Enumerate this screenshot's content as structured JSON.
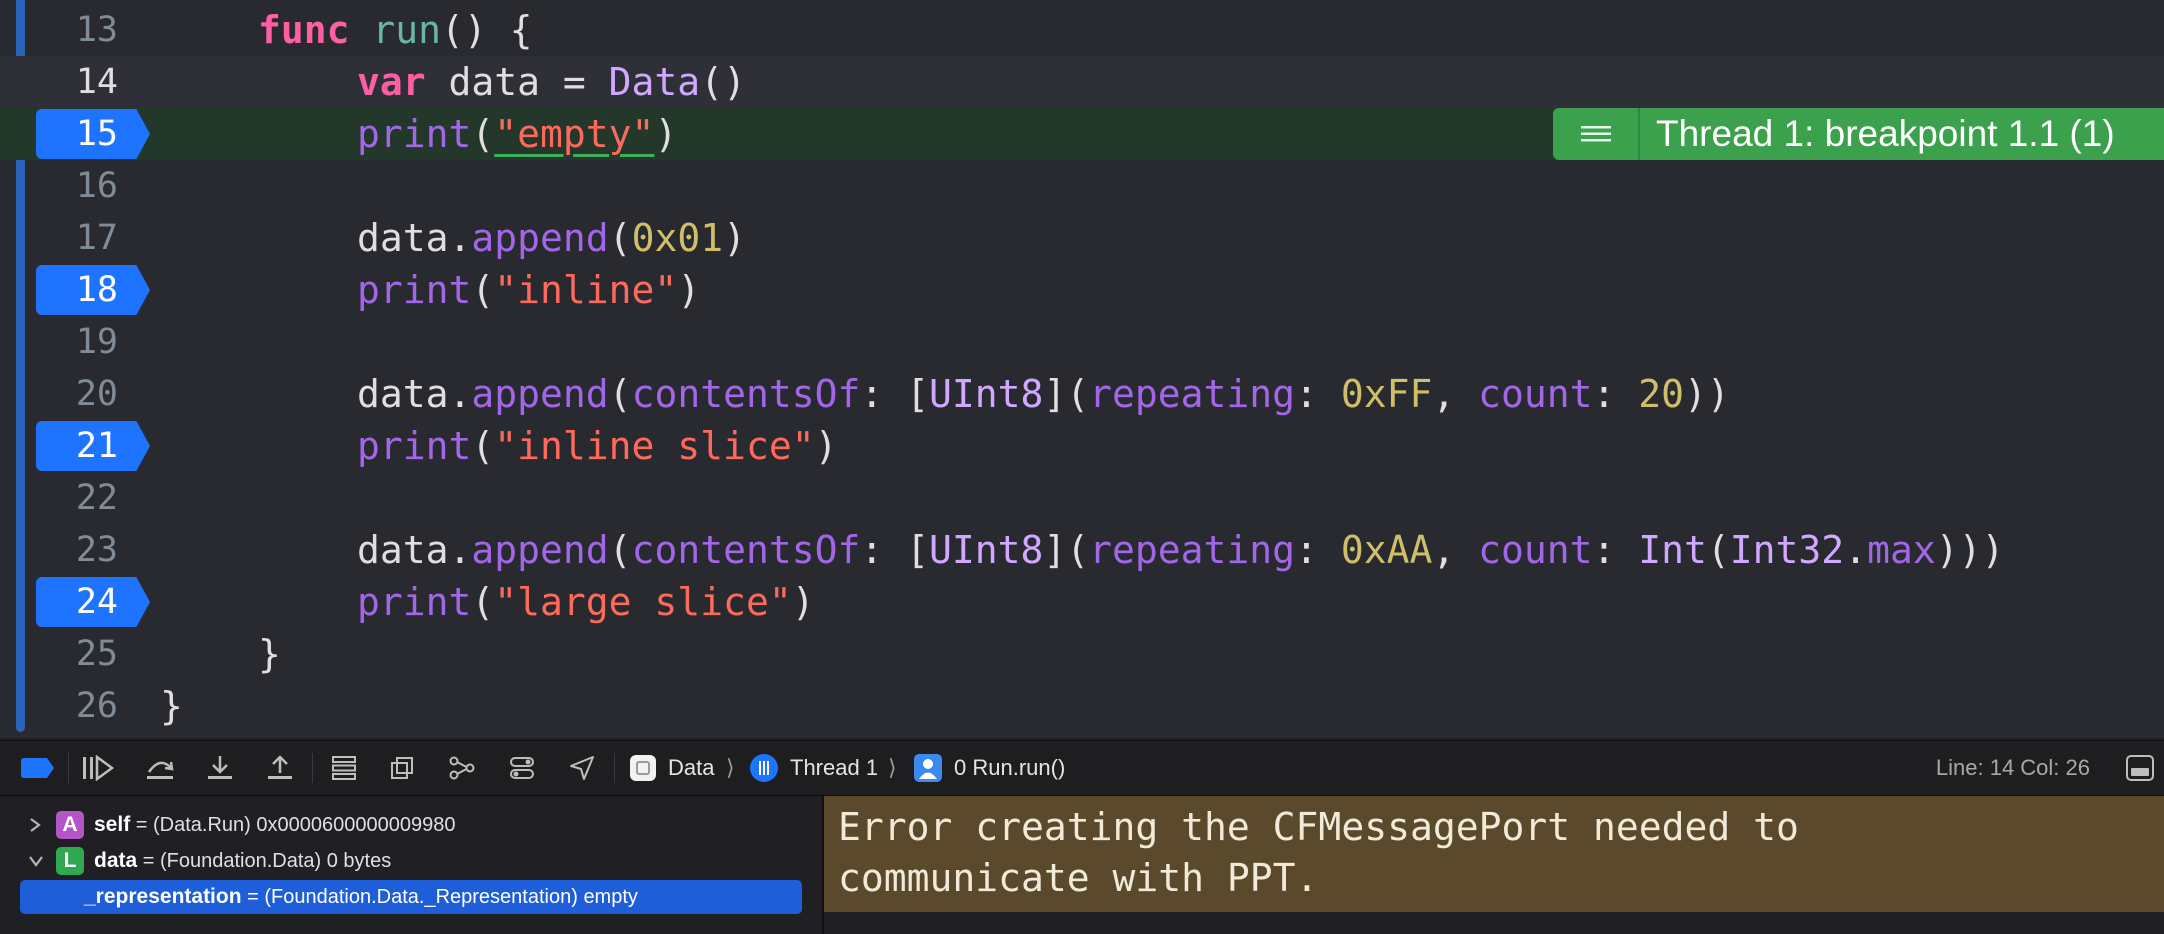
{
  "editor": {
    "lines": [
      {
        "num": "13",
        "tokens": [
          [
            "kw",
            "func"
          ],
          [
            "pl",
            " "
          ],
          [
            "fn",
            "run"
          ],
          [
            "pl",
            "() {"
          ]
        ]
      },
      {
        "num": "14",
        "tokens": [
          [
            "kw",
            "var"
          ],
          [
            "pl",
            " data = "
          ],
          [
            "ty",
            "Data"
          ],
          [
            "pl",
            "()"
          ]
        ]
      },
      {
        "num": "15",
        "tokens": [
          [
            "me",
            "print"
          ],
          [
            "pl",
            "("
          ],
          [
            "str-u",
            "\"empty\""
          ],
          [
            "pl",
            ")"
          ]
        ]
      },
      {
        "num": "16",
        "tokens": []
      },
      {
        "num": "17",
        "tokens": [
          [
            "pl",
            "data."
          ],
          [
            "me",
            "append"
          ],
          [
            "pl",
            "("
          ],
          [
            "num",
            "0x01"
          ],
          [
            "pl",
            ")"
          ]
        ]
      },
      {
        "num": "18",
        "tokens": [
          [
            "me",
            "print"
          ],
          [
            "pl",
            "("
          ],
          [
            "str",
            "\"inline\""
          ],
          [
            "pl",
            ")"
          ]
        ]
      },
      {
        "num": "19",
        "tokens": []
      },
      {
        "num": "20",
        "tokens": [
          [
            "pl",
            "data."
          ],
          [
            "me",
            "append"
          ],
          [
            "pl",
            "("
          ],
          [
            "me",
            "contentsOf"
          ],
          [
            "pl",
            ": ["
          ],
          [
            "ty",
            "UInt8"
          ],
          [
            "pl",
            "]("
          ],
          [
            "me",
            "repeating"
          ],
          [
            "pl",
            ": "
          ],
          [
            "num",
            "0xFF"
          ],
          [
            "pl",
            ", "
          ],
          [
            "me",
            "count"
          ],
          [
            "pl",
            ": "
          ],
          [
            "num",
            "20"
          ],
          [
            "pl",
            "))"
          ]
        ]
      },
      {
        "num": "21",
        "tokens": [
          [
            "me",
            "print"
          ],
          [
            "pl",
            "("
          ],
          [
            "str",
            "\"inline slice\""
          ],
          [
            "pl",
            ")"
          ]
        ]
      },
      {
        "num": "22",
        "tokens": []
      },
      {
        "num": "23",
        "tokens": [
          [
            "pl",
            "data."
          ],
          [
            "me",
            "append"
          ],
          [
            "pl",
            "("
          ],
          [
            "me",
            "contentsOf"
          ],
          [
            "pl",
            ": ["
          ],
          [
            "ty",
            "UInt8"
          ],
          [
            "pl",
            "]("
          ],
          [
            "me",
            "repeating"
          ],
          [
            "pl",
            ": "
          ],
          [
            "num",
            "0xAA"
          ],
          [
            "pl",
            ", "
          ],
          [
            "me",
            "count"
          ],
          [
            "pl",
            ": "
          ],
          [
            "ty",
            "Int"
          ],
          [
            "pl",
            "("
          ],
          [
            "ty",
            "Int32"
          ],
          [
            "pl",
            "."
          ],
          [
            "me",
            "max"
          ],
          [
            "pl",
            ")))"
          ]
        ]
      },
      {
        "num": "24",
        "tokens": [
          [
            "me",
            "print"
          ],
          [
            "pl",
            "("
          ],
          [
            "str",
            "\"large slice\""
          ],
          [
            "pl",
            ")"
          ]
        ]
      },
      {
        "num": "25",
        "tokens": [
          [
            "pl",
            "}"
          ]
        ]
      },
      {
        "num": "26",
        "tokens": [
          [
            "pl",
            "}"
          ]
        ]
      }
    ],
    "breakpoint_lines": [
      "15",
      "18",
      "21",
      "24"
    ],
    "current_line": "14",
    "stopped_line": "15",
    "thread_badge": "Thread 1: breakpoint 1.1 (1)"
  },
  "debug_bar": {
    "crumbs": {
      "target": "Data",
      "thread": "Thread 1",
      "frame": "0 Run.run()"
    },
    "line_col": "Line: 14  Col: 26",
    "icons": [
      "breakpoints-toggle-icon",
      "continue-icon",
      "step-over-icon",
      "step-into-icon",
      "step-out-icon",
      "view-hierarchy-icon",
      "memory-graph-icon",
      "environment-icon",
      "overrides-icon",
      "location-icon"
    ]
  },
  "variables": [
    {
      "badge": "A",
      "badge_color": "#b455c8",
      "name": "self",
      "value": " = (Data.Run) 0x0000600000009980",
      "expanded": false
    },
    {
      "badge": "L",
      "badge_color": "#2fa84f",
      "name": "data",
      "value": " = (Foundation.Data) 0 bytes",
      "expanded": true
    },
    {
      "name": "_representation",
      "value": " = (Foundation.Data._Representation) empty",
      "selected": true
    }
  ],
  "console": {
    "message": "Error creating the CFMessagePort needed to\ncommunicate with PPT."
  },
  "colors": {
    "breakpoint": "#1e74ff",
    "thread_badge": "#3ba14c",
    "console_warning_bg": "#5a4a2b"
  }
}
